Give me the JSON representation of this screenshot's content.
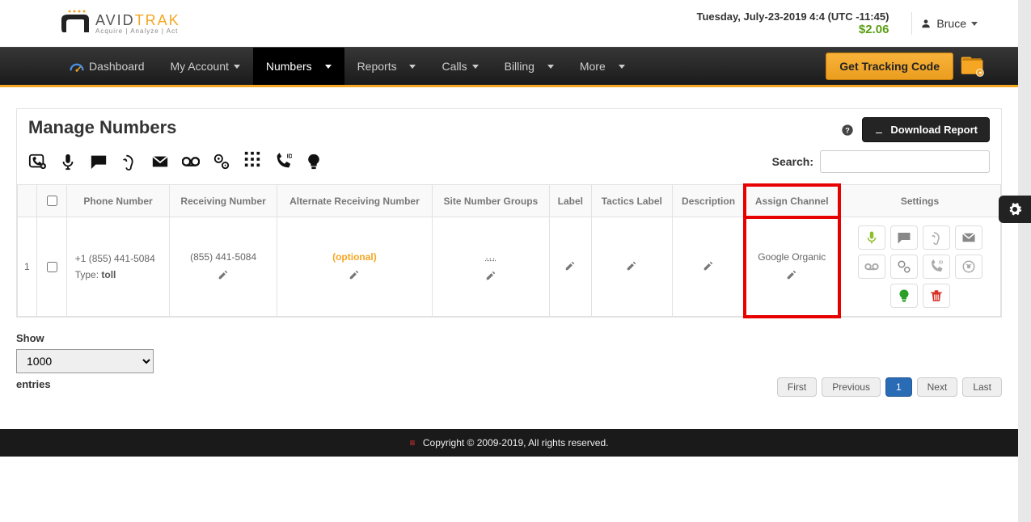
{
  "header": {
    "datetime": "Tuesday, July-23-2019 4:4 (UTC -11:45)",
    "balance": "$2.06",
    "username": "Bruce",
    "logo_left": "AVID",
    "logo_right": "TRAK",
    "logo_sub": "Acquire | Analyze | Act"
  },
  "nav": {
    "dashboard": "Dashboard",
    "my_account": "My Account",
    "numbers": "Numbers",
    "reports": "Reports",
    "calls": "Calls",
    "billing": "Billing",
    "more": "More",
    "tracking_code_btn": "Get Tracking Code"
  },
  "panel": {
    "title": "Manage Numbers",
    "download_btn": "Download Report",
    "search_label": "Search:"
  },
  "table": {
    "headers": {
      "phone_number": "Phone Number",
      "receiving_number": "Receiving Number",
      "alt_receiving": "Alternate Receiving Number",
      "site_groups": "Site Number Groups",
      "label": "Label",
      "tactics_label": "Tactics Label",
      "description": "Description",
      "assign_channel": "Assign Channel",
      "settings": "Settings"
    },
    "rows": [
      {
        "index": "1",
        "phone": "+1 (855) 441-5084",
        "type_label": "Type:",
        "type_value": "toll",
        "receiving": "(855) 441-5084",
        "alt": "(optional)",
        "site_groups": "...",
        "channel": "Google Organic"
      }
    ]
  },
  "entries": {
    "show": "Show",
    "value": "1000",
    "entries": "entries"
  },
  "pagination": {
    "first": "First",
    "previous": "Previous",
    "page1": "1",
    "next": "Next",
    "last": "Last"
  },
  "footer": {
    "copyright": "Copyright © 2009-2019, All rights reserved."
  }
}
